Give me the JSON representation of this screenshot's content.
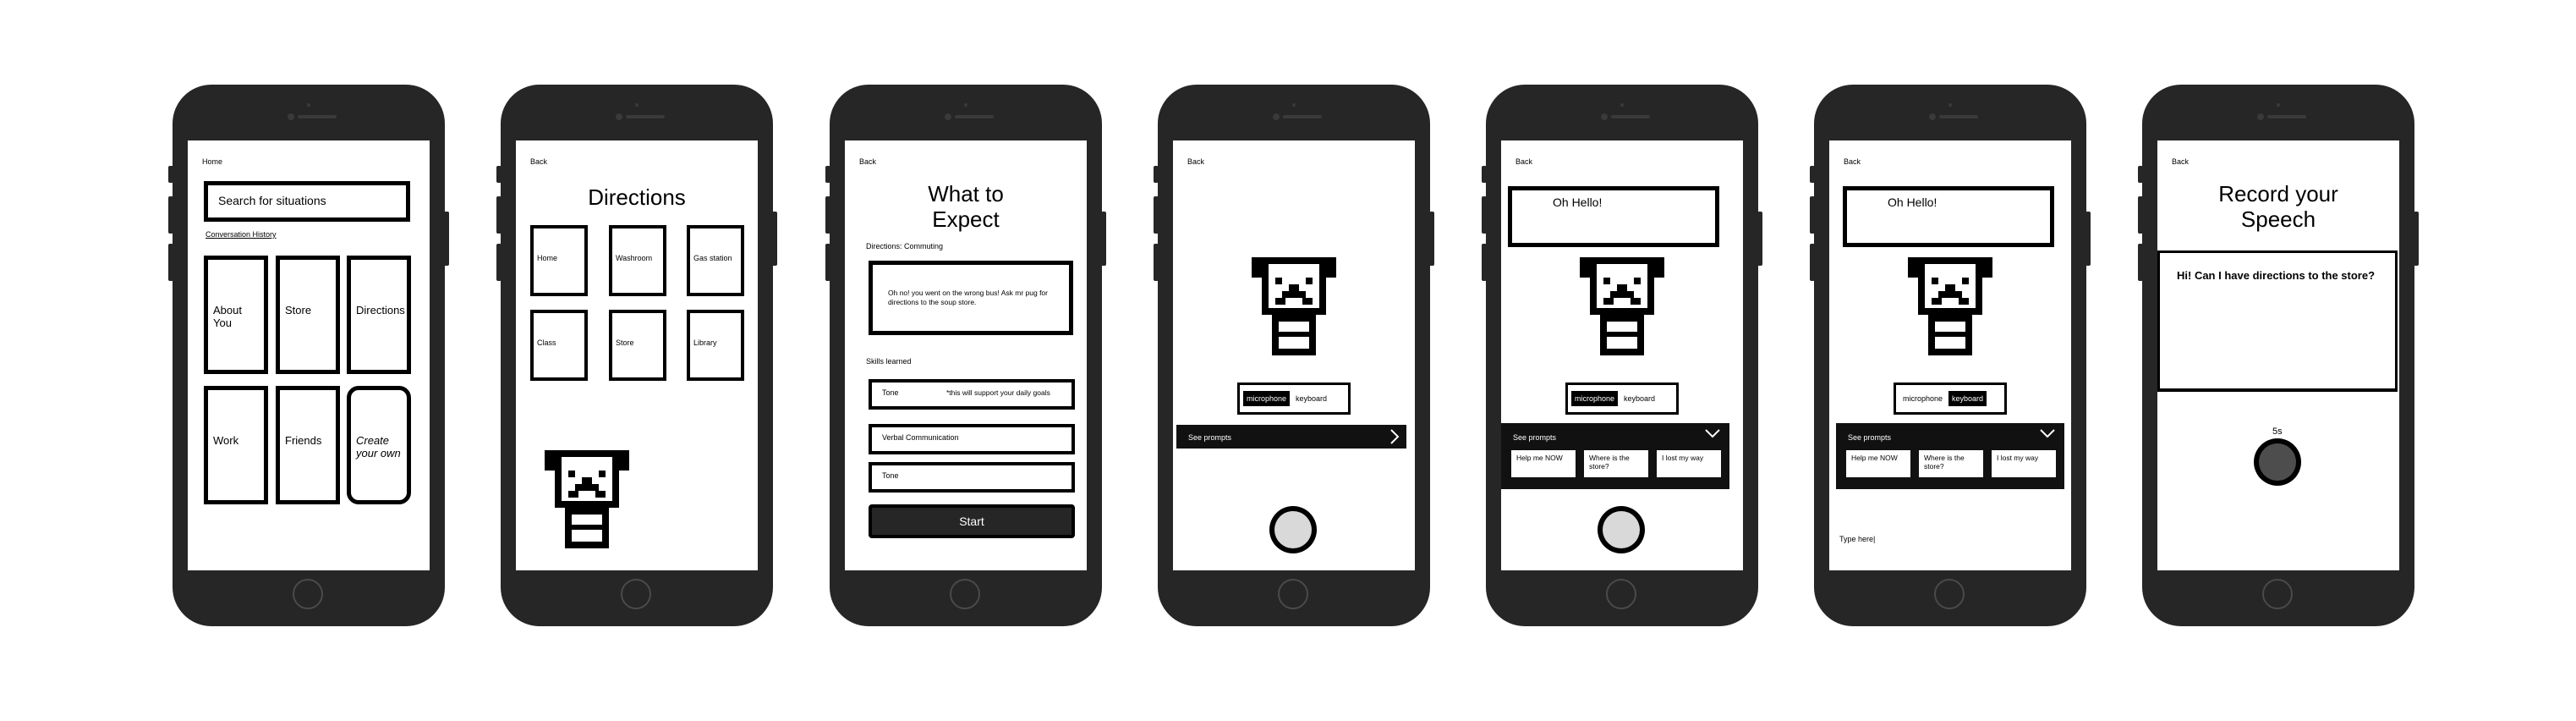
{
  "screens": {
    "s1": {
      "nav": "Home",
      "search_placeholder": "Search for situations",
      "history_link": "Conversation History",
      "tiles": [
        "About You",
        "Store",
        "Directions",
        "Work",
        "Friends",
        "Create your own"
      ]
    },
    "s2": {
      "back": "Back",
      "title": "Directions",
      "tiles": [
        "Home",
        "Washroom",
        "Gas station",
        "Class",
        "Store",
        "Library"
      ]
    },
    "s3": {
      "back": "Back",
      "title": "What to Expect",
      "context_label": "Directions: Commuting",
      "scenario": "Oh no! you went on the wrong bus! Ask mr pug for directions to the soup store.",
      "skills_label": "Skills learned",
      "skills": [
        {
          "name": "Tone",
          "note": "*this will support your daily goals"
        },
        {
          "name": "Verbal Communication",
          "note": ""
        },
        {
          "name": "Tone",
          "note": ""
        }
      ],
      "start": "Start"
    },
    "s4": {
      "back": "Back",
      "mode_microphone": "microphone",
      "mode_keyboard": "keyboard",
      "see_prompts": "See prompts"
    },
    "s5": {
      "back": "Back",
      "speech": "Oh Hello!",
      "mode_microphone": "microphone",
      "mode_keyboard": "keyboard",
      "see_prompts": "See prompts",
      "prompts": [
        "Help me NOW",
        "Where is the store?",
        "I lost my way"
      ]
    },
    "s6": {
      "back": "Back",
      "speech": "Oh Hello!",
      "mode_microphone": "microphone",
      "mode_keyboard": "keyboard",
      "see_prompts": "See prompts",
      "prompts": [
        "Help me NOW",
        "Where is the store?",
        "I lost my way"
      ],
      "type_placeholder": "Type here|"
    },
    "s7": {
      "back": "Back",
      "title": "Record your Speech",
      "transcript": "Hi! Can I have directions to the store?",
      "timer": "5s"
    }
  },
  "colors": {
    "ink": "#000000",
    "phone": "#262626",
    "button_fill": "#d9d9d9",
    "record_active": "#4d4d4d"
  }
}
